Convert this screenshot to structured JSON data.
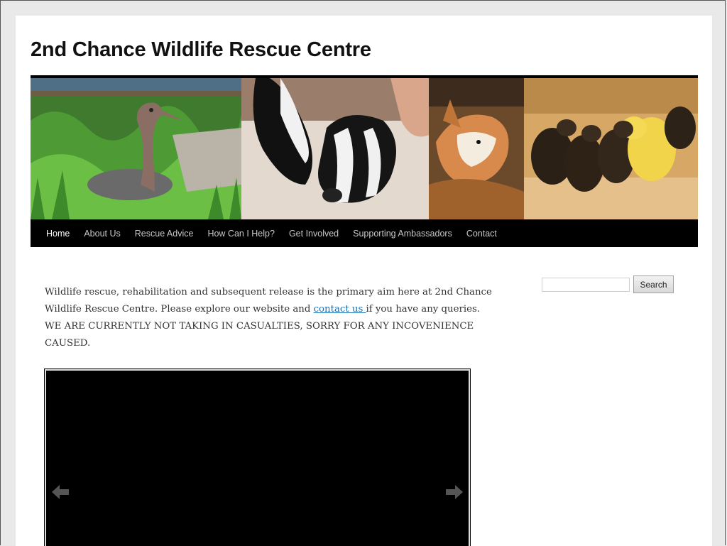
{
  "site": {
    "title": "2nd Chance Wildlife Rescue Centre"
  },
  "nav": {
    "items": [
      {
        "label": "Home",
        "active": true
      },
      {
        "label": "About Us"
      },
      {
        "label": "Rescue Advice"
      },
      {
        "label": "How Can I Help?"
      },
      {
        "label": "Get Involved"
      },
      {
        "label": "Supporting Ambassadors"
      },
      {
        "label": "Contact"
      }
    ]
  },
  "intro": {
    "text_before": "Wildlife rescue, rehabilitation and subsequent release is the primary aim here at 2nd Chance Wildlife Rescue Centre.  Please explore our website and ",
    "link": "contact us ",
    "text_after": "if you have any queries.  WE ARE CURRENTLY NOT TAKING IN CASUALTIES, SORRY FOR ANY INCOVENIENCE CAUSED."
  },
  "search": {
    "placeholder": "",
    "button_label": "Search"
  },
  "colors": {
    "nav_background": "#000000",
    "link": "#1b6fb0",
    "page_background": "#ffffff"
  },
  "icons": {
    "slider_prev": "arrow-left-icon",
    "slider_next": "arrow-right-icon"
  }
}
